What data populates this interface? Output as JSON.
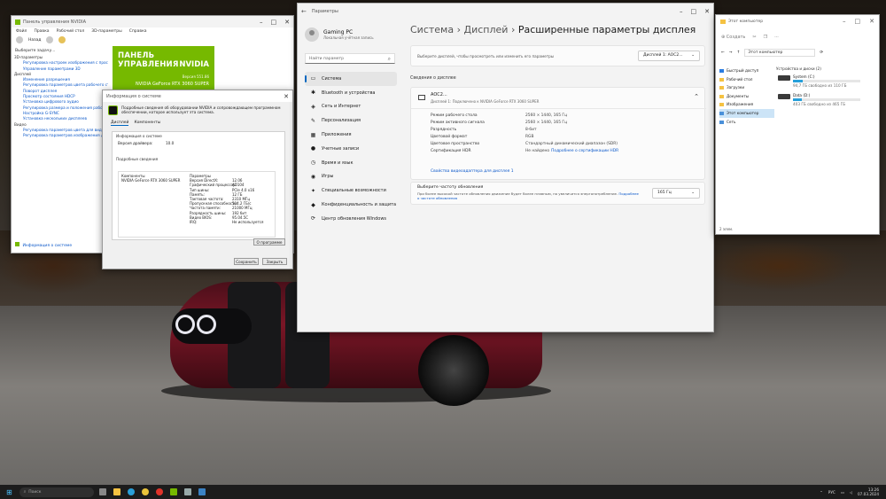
{
  "colors": {
    "accent": "#0067c0",
    "nvidia": "#76b900",
    "taskbar": "#1c1c1c"
  },
  "nvidia_panel": {
    "title": "Панель управления NVIDIA",
    "menu": [
      "Файл",
      "Правка",
      "Рабочий стол",
      "3D-параметры",
      "Справка"
    ],
    "back_label": "Назад",
    "task_label": "Выберите задачу...",
    "tree": [
      {
        "label": "3D-параметры",
        "head": true
      },
      {
        "label": "Регулировка настроек изображения с просмотром",
        "head": false
      },
      {
        "label": "Управление параметрами 3D",
        "head": false
      },
      {
        "label": "Дисплей",
        "head": true
      },
      {
        "label": "Изменение разрешения",
        "head": false
      },
      {
        "label": "Регулировка параметров цвета рабочего стола",
        "head": false
      },
      {
        "label": "Поворот дисплея",
        "head": false
      },
      {
        "label": "Просмотр состояния HDCP",
        "head": false
      },
      {
        "label": "Установка цифрового аудио",
        "head": false
      },
      {
        "label": "Регулировка размера и положения рабочего стола",
        "head": false
      },
      {
        "label": "Настройка G-SYNC",
        "head": false
      },
      {
        "label": "Установка нескольких дисплеев",
        "head": false
      },
      {
        "label": "Видео",
        "head": true
      },
      {
        "label": "Регулировка параметров цвета для видео",
        "head": false
      },
      {
        "label": "Регулировка параметров изображения для видео",
        "head": false
      }
    ],
    "logo": {
      "line1": "ПАНЕЛЬ УПРАВЛЕНИЯ",
      "line2": "NVIDIA",
      "driver": "Версия 551.86",
      "gpu": "NVIDIA GeForce RTX 3060 SUPER"
    },
    "footer_link": "Информация о системе"
  },
  "info_dialog": {
    "title": "Информация о системе",
    "message": "Подробные сведения об оборудовании NVIDIA и сопровождающем программном обеспечении, которое использует эта система.",
    "tabs": [
      "Дисплей",
      "Компоненты"
    ],
    "group_system": "Информация о системе",
    "api_label": "Версия драйвера:",
    "api_value": "10.0",
    "group_details": "Подробные сведения",
    "col_component": "Компоненты",
    "col_params": "Параметры",
    "gpu_name": "NVIDIA GeForce RTX 3060 SUPER",
    "params": [
      {
        "k": "Версия DirectX:",
        "v": "12.06"
      },
      {
        "k": "Графический процессор:",
        "v": "AD104"
      },
      {
        "k": "Тип шины:",
        "v": "PCIe 4.0 x16"
      },
      {
        "k": "Память:",
        "v": "12 ГБ"
      },
      {
        "k": "Тактовая частота:",
        "v": "2310 МГц"
      },
      {
        "k": "Пропускная способность:",
        "v": "504.2 ГБ/с"
      },
      {
        "k": "Частота памяти:",
        "v": "21000 МГц"
      },
      {
        "k": "Разрядность шины:",
        "v": "192 бит"
      },
      {
        "k": "Видео BIOS:",
        "v": "95.04.5C"
      },
      {
        "k": "IRQ:",
        "v": "Не используется"
      }
    ],
    "about_btn": "О программе",
    "save_btn": "Сохранить",
    "close_btn": "Закрыть"
  },
  "settings": {
    "title": "Параметры",
    "user": {
      "name": "Gaming PC",
      "account": "Локальная учётная запись"
    },
    "search_placeholder": "Найти параметр",
    "nav": [
      {
        "icon": "▭",
        "label": "Система",
        "selected": true
      },
      {
        "icon": "✱",
        "label": "Bluetooth и устройства",
        "selected": false
      },
      {
        "icon": "◈",
        "label": "Сеть и Интернет",
        "selected": false
      },
      {
        "icon": "✎",
        "label": "Персонализация",
        "selected": false
      },
      {
        "icon": "▦",
        "label": "Приложения",
        "selected": false
      },
      {
        "icon": "●",
        "label": "Учетные записи",
        "selected": false
      },
      {
        "icon": "◷",
        "label": "Время и язык",
        "selected": false
      },
      {
        "icon": "◉",
        "label": "Игры",
        "selected": false
      },
      {
        "icon": "✦",
        "label": "Специальные возможности",
        "selected": false
      },
      {
        "icon": "◆",
        "label": "Конфиденциальность и защита",
        "selected": false
      },
      {
        "icon": "⟳",
        "label": "Центр обновления Windows",
        "selected": false
      }
    ],
    "breadcrumb": {
      "a": "Система",
      "b": "Дисплей",
      "c": "Расширенные параметры дисплея"
    },
    "select_text": "Выберите дисплей, чтобы просмотреть или изменить его параметры",
    "select_value": "Дисплей 1: AOC2...",
    "section_title": "Сведения о дисплее",
    "monitor": {
      "name": "AOC2...",
      "sub": "Дисплей 1: Подключено к NVIDIA GeForce RTX 3060 SUPER"
    },
    "details": [
      {
        "k": "Режим рабочего стола",
        "v": "2560 × 1440, 165 Гц"
      },
      {
        "k": "Режим активного сигнала",
        "v": "2560 × 1440, 165 Гц"
      },
      {
        "k": "Разрядность",
        "v": "8-бит"
      },
      {
        "k": "Цветовой формат",
        "v": "RGB"
      },
      {
        "k": "Цветовое пространство",
        "v": "Стандартный динамический диапазон (SDR)"
      },
      {
        "k": "Сертификация HDR",
        "v": "Не найдено"
      }
    ],
    "hdr_link": "Подробнее о сертификации HDR",
    "adapter_link": "Свойства видеоадаптера для дисплея 1",
    "refresh_title": "Выберите частоту обновления",
    "refresh_sub": "При более высокой частоте обновления движение будет более плавным, но увеличится энергопотребление.",
    "refresh_link": "Подробнее о частоте обновления",
    "refresh_value": "165 Гц"
  },
  "explorer": {
    "title": "Этот компьютер",
    "new_label": "Создать",
    "address": "Этот компьютер",
    "side": [
      "Быстрый доступ",
      "Рабочий стол",
      "Загрузки",
      "Документы",
      "Изображения",
      "Этот компьютер",
      "Сеть"
    ],
    "group": "Устройства и диски (2)",
    "drives": [
      {
        "name": "System (C:)",
        "free": "94,7 ГБ свободно из 110 ГБ",
        "fill": 0.14
      },
      {
        "name": "Data (D:)",
        "free": "403 ГБ свободно из 465 ГБ",
        "fill": 0.13
      }
    ],
    "status": "2 элем."
  },
  "taskbar": {
    "search": "Поиск",
    "lang": "РУС",
    "time": "13:26",
    "date": "07.03.2024"
  }
}
